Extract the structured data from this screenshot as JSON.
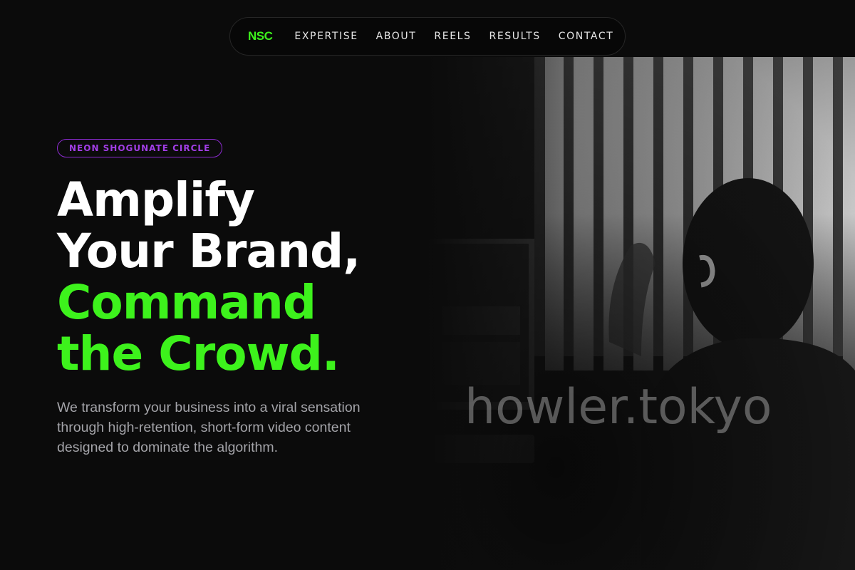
{
  "nav": {
    "logo": "NSC",
    "links": [
      "EXPERTISE",
      "ABOUT",
      "REELS",
      "RESULTS",
      "CONTACT"
    ]
  },
  "hero": {
    "badge": "NEON SHOGUNATE CIRCLE",
    "headline_lines": [
      "Amplify",
      "Your Brand,",
      "Command",
      "the Crowd."
    ],
    "subtext": "We transform your business into a viral sensation through high-retention, short-form video content designed to dominate the algorithm.",
    "photo": {
      "description_icon": "editor-at-desk-photo",
      "watermark": "howler.tokyo"
    }
  },
  "colors": {
    "background": "#0b0b0b",
    "accent_green": "#3df21c",
    "accent_purple": "#a23ee6",
    "text_white": "#ffffff",
    "text_muted": "#a3a3a8"
  }
}
